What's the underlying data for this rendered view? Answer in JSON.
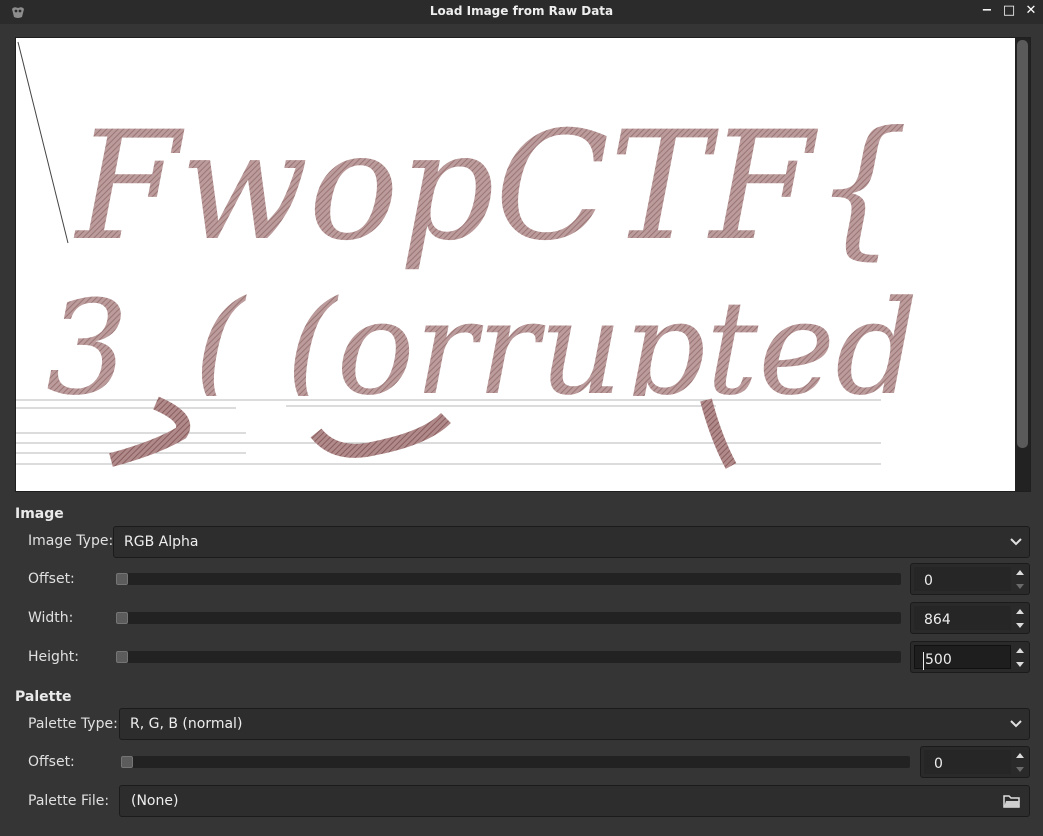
{
  "window": {
    "title": "Load Image from Raw Data",
    "app_icon": "gimp-icon",
    "controls": {
      "minimize": "−",
      "maximize": "□",
      "close": "✕"
    }
  },
  "preview": {
    "icon": "raw-image-preview",
    "line1": "FwopCTF{",
    "line2": "3_( (orrupted"
  },
  "image_section": {
    "heading": "Image",
    "image_type_label": "Image Type:",
    "image_type_value": "RGB Alpha",
    "offset_label": "Offset:",
    "offset_value": "0",
    "width_label": "Width:",
    "width_value": "864",
    "height_label": "Height:",
    "height_value": "500"
  },
  "palette_section": {
    "heading": "Palette",
    "palette_type_label": "Palette Type:",
    "palette_type_value": "R, G, B (normal)",
    "offset_label": "Offset:",
    "offset_value": "0",
    "palette_file_label": "Palette File:",
    "palette_file_value": "(None)"
  },
  "colors": {
    "background": "#353535",
    "titlebar": "#2b2b2b",
    "ink": "#9a6a6a"
  }
}
